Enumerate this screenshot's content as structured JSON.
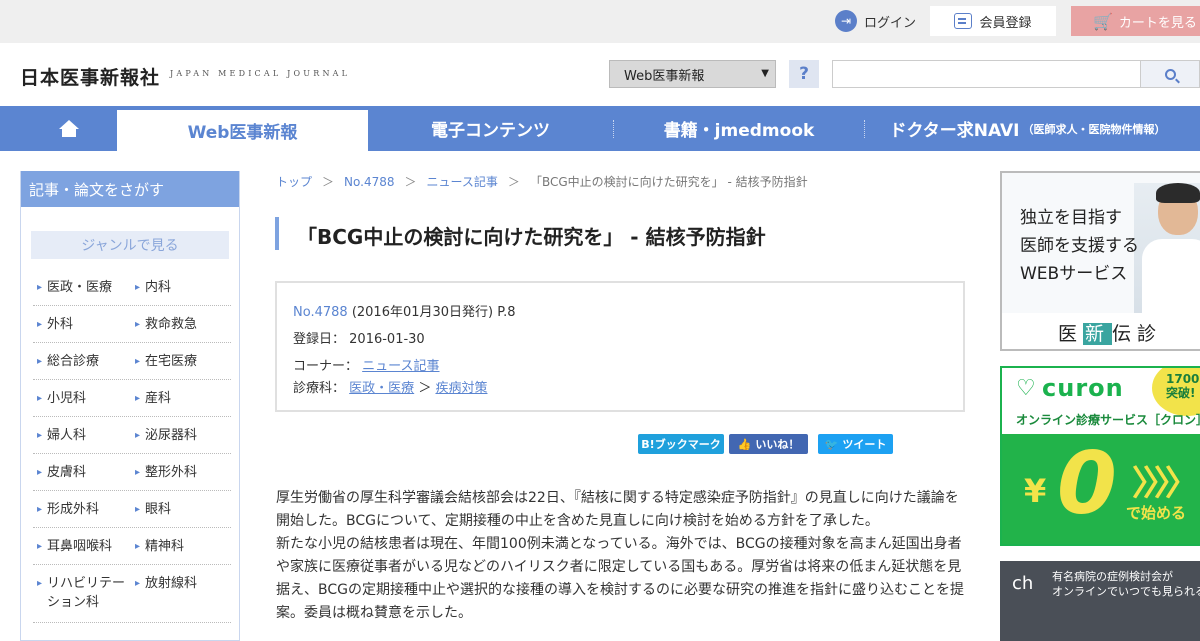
{
  "top_bar": {
    "login_label": "ログイン",
    "register_label": "会員登録",
    "cart_label": "カートを見る"
  },
  "header": {
    "logo_text": "日本医事新報社",
    "logo_sub": "JAPAN MEDICAL JOURNAL",
    "search_scope": "Web医事新報",
    "help_label": "?",
    "search_value": ""
  },
  "nav": {
    "tabs": [
      {
        "label": "Web医事新報",
        "active": true
      },
      {
        "label": "電子コンテンツ"
      },
      {
        "label": "書籍・jmedmook"
      },
      {
        "label": "ドクター求NAVI",
        "small": "（医師求人・医院物件情報）"
      }
    ]
  },
  "sidebar": {
    "heading": "記事・論文をさがす",
    "genre_label": "ジャンルで見る",
    "genres": [
      [
        "医政・医療",
        "内科"
      ],
      [
        "外科",
        "救命救急"
      ],
      [
        "総合診療",
        "在宅医療"
      ],
      [
        "小児科",
        "産科"
      ],
      [
        "婦人科",
        "泌尿器科"
      ],
      [
        "皮膚科",
        "整形外科"
      ],
      [
        "形成外科",
        "眼科"
      ],
      [
        "耳鼻咽喉科",
        "精神科"
      ],
      [
        "リハビリテーション科",
        "放射線科"
      ]
    ]
  },
  "breadcrumb": {
    "items": [
      "トップ",
      "No.4788",
      "ニュース記事"
    ],
    "separator": "＞",
    "current": "「BCG中止の検討に向けた研究を」 - 結核予防指針"
  },
  "article": {
    "title": "「BCG中止の検討に向けた研究を」 - 結核予防指針",
    "issue_link": "No.4788",
    "issue_detail": "(2016年01月30日発行) P.8",
    "registered_label": "登録日：",
    "registered_date": "2016-01-30",
    "corner_label": "コーナー：",
    "corner_value": "ニュース記事",
    "dept_label": "診療科：",
    "dept_value_1": "医政・医療",
    "dept_sep": "＞",
    "dept_value_2": "疾病対策",
    "paragraphs": [
      "厚生労働省の厚生科学審議会結核部会は22日、『結核に関する特定感染症予防指針』の見直しに向けた議論を開始した。BCGについて、定期接種の中止を含めた見直しに向け検討を始める方針を了承した。",
      "新たな小児の結核患者は現在、年間100例未満となっている。海外では、BCGの接種対象を高まん延国出身者や家族に医療従事者がいる児などのハイリスク者に限定している国もある。厚労省は将来の低まん延状態を見据え、BCGの定期接種中止や選択的な接種の導入を検討するのに必要な研究の推進を指針に盛り込むことを提案。委員は概ね賛意を示した。"
    ]
  },
  "share": {
    "hatena": "B!ブックマーク",
    "facebook": "いいね！",
    "twitter": "ツイート"
  },
  "banners": {
    "b1_lines": [
      "独立を目指す",
      "医師を支援する",
      "WEBサービス"
    ],
    "b1_logo_a": "医",
    "b1_logo_b": "新",
    "b1_logo_c": "伝診",
    "b2_brand": "curon",
    "b2_badge_1": "1700",
    "b2_badge_2": "突破!",
    "b2_sub": "オンライン診療サービス［クロン］",
    "b2_yen": "¥",
    "b2_zero": "0",
    "b2_arrows": "〉〉〉〉",
    "b2_start": "で始める",
    "b3_logo": "ch",
    "b3_line1": "有名病院の症例検討会が",
    "b3_line2": "オンラインでいつでも見られる"
  }
}
